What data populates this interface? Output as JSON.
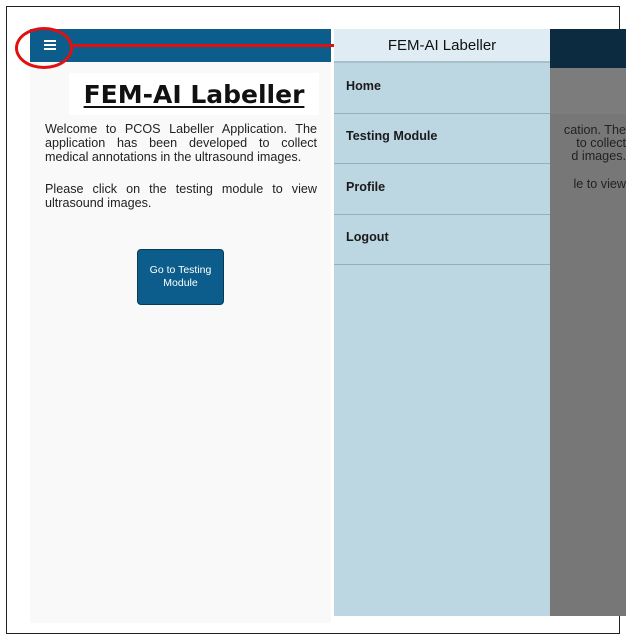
{
  "app": {
    "title": "FEM-AI Labeller"
  },
  "home": {
    "heading": "FEM-AI Labeller",
    "welcome_text": "Welcome to PCOS Labeller Application. The application has been developed to collect medical annotations in the ultrasound images.",
    "instruction_text": "Please click on the testing module to view ultrasound images.",
    "go_button_label": "Go to Testing Module"
  },
  "drawer": {
    "header": "FEM-AI Labeller",
    "items": [
      {
        "label": "Home"
      },
      {
        "label": "Testing Module"
      },
      {
        "label": "Profile"
      },
      {
        "label": "Logout"
      }
    ]
  },
  "behind_drawer_text": {
    "line1": "cation. The",
    "line2": "to collect",
    "line3": "d images.",
    "line4": "le to view"
  },
  "colors": {
    "app_bar": "#0c5d8c",
    "drawer_bg": "#bcd6e2",
    "drawer_header_bg": "#dfecf3",
    "highlight_annotation": "#e01010",
    "overlay": "#777777"
  },
  "icons": {
    "menu": "hamburger-menu-icon",
    "annotation_arrow": "arrow-right-icon"
  }
}
